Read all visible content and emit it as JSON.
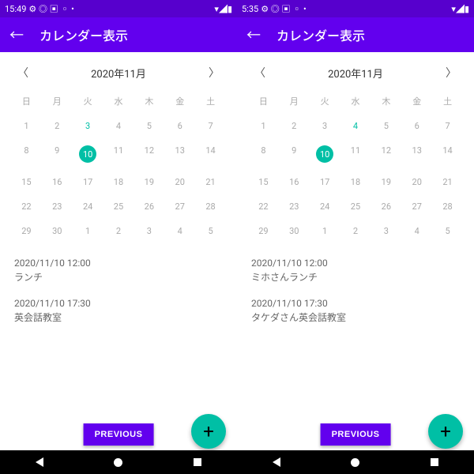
{
  "screens": [
    {
      "status": {
        "time": "15:49",
        "icons_left": "✿ ◎ ▣ ▫ •",
        "icons_right": "▾◢▮ 5:35 ✿ ◎ ▣ ▫ •"
      },
      "status_time": "15:49",
      "status_right": "▼◢▮",
      "app_title": "カレンダー表示",
      "month_label": "2020年11月",
      "dow": [
        "日",
        "月",
        "火",
        "水",
        "木",
        "金",
        "土"
      ],
      "weeks": [
        [
          1,
          2,
          3,
          4,
          5,
          6,
          7
        ],
        [
          8,
          9,
          10,
          11,
          12,
          13,
          14
        ],
        [
          15,
          16,
          17,
          18,
          19,
          20,
          21
        ],
        [
          22,
          23,
          24,
          25,
          26,
          27,
          28
        ],
        [
          29,
          30,
          1,
          2,
          3,
          4,
          5
        ]
      ],
      "today": 3,
      "selected": 10,
      "events": [
        {
          "time": "2020/11/10 12:00",
          "title": "ランチ"
        },
        {
          "time": "2020/11/10 17:30",
          "title": "英会話教室"
        }
      ],
      "prev_label": "PREVIOUS",
      "fab_label": "+"
    },
    {
      "status_time": "5:35",
      "status_right": "▼◢▮",
      "app_title": "カレンダー表示",
      "month_label": "2020年11月",
      "dow": [
        "日",
        "月",
        "火",
        "水",
        "木",
        "金",
        "土"
      ],
      "weeks": [
        [
          1,
          2,
          3,
          4,
          5,
          6,
          7
        ],
        [
          8,
          9,
          10,
          11,
          12,
          13,
          14
        ],
        [
          15,
          16,
          17,
          18,
          19,
          20,
          21
        ],
        [
          22,
          23,
          24,
          25,
          26,
          27,
          28
        ],
        [
          29,
          30,
          1,
          2,
          3,
          4,
          5
        ]
      ],
      "today": 4,
      "selected": 10,
      "events": [
        {
          "time": "2020/11/10 12:00",
          "title": "ミホさんランチ"
        },
        {
          "time": "2020/11/10 17:30",
          "title": "タケダさん英会話教室"
        }
      ],
      "prev_label": "PREVIOUS",
      "fab_label": "+"
    }
  ],
  "chevron_left": "〈",
  "chevron_right": "〉",
  "status_icons_left": "✿ ◎ ▣ ▫ •"
}
